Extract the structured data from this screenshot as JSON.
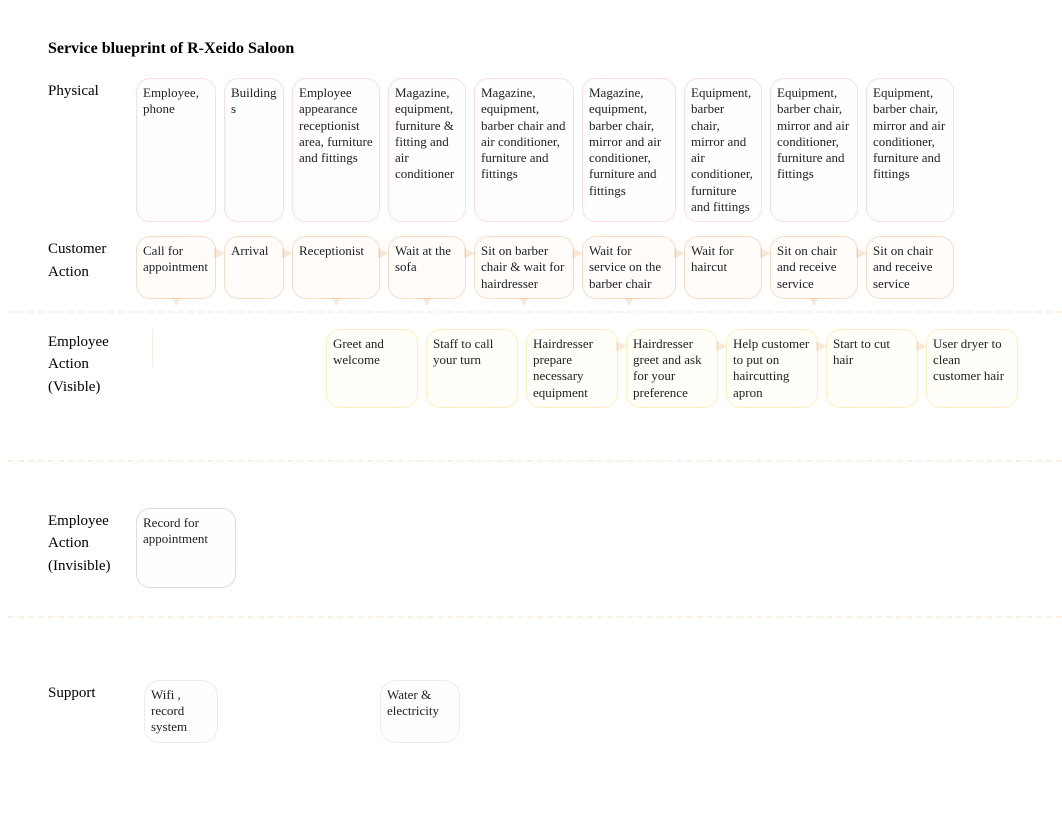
{
  "title": "Service blueprint of R-Xeido Saloon",
  "row_labels": {
    "physical": "Physical",
    "customer": "Customer Action",
    "visible": "Employee Action (Visible)",
    "invisible": "Employee Action (Invisible)",
    "support": "Support"
  },
  "physical": [
    "Employee, phone",
    "Buildings",
    "Employee appearance receptionist area, furniture and fittings",
    "Magazine, equipment, furniture & fitting and air conditioner",
    "Magazine, equipment, barber chair and air conditioner, furniture and fittings",
    "Magazine, equipment, barber chair, mirror and air conditioner, furniture and fittings",
    "Equipment, barber chair, mirror and air conditioner, furniture and fittings",
    "Equipment, barber chair, mirror and air conditioner, furniture and fittings",
    "Equipment, barber chair, mirror and air conditioner, furniture and fittings"
  ],
  "customer": [
    "Call for appointment",
    "Arrival",
    "Receptionist",
    "Wait at the sofa",
    "Sit on barber chair & wait for hairdresser",
    "Wait for service on the barber chair",
    "Wait for haircut",
    "Sit on chair and receive service",
    "Sit on chair and receive service"
  ],
  "visible": [
    "Greet and welcome",
    "Staff to call your turn",
    "Hairdresser prepare necessary equipment",
    "Hairdresser greet and ask for your preference",
    "Help customer to put on haircutting apron",
    "Start to cut hair",
    "User dryer to clean customer hair"
  ],
  "invisible": [
    "Record for appointment"
  ],
  "support": [
    "Wifi , record system",
    "Water & electricity"
  ]
}
